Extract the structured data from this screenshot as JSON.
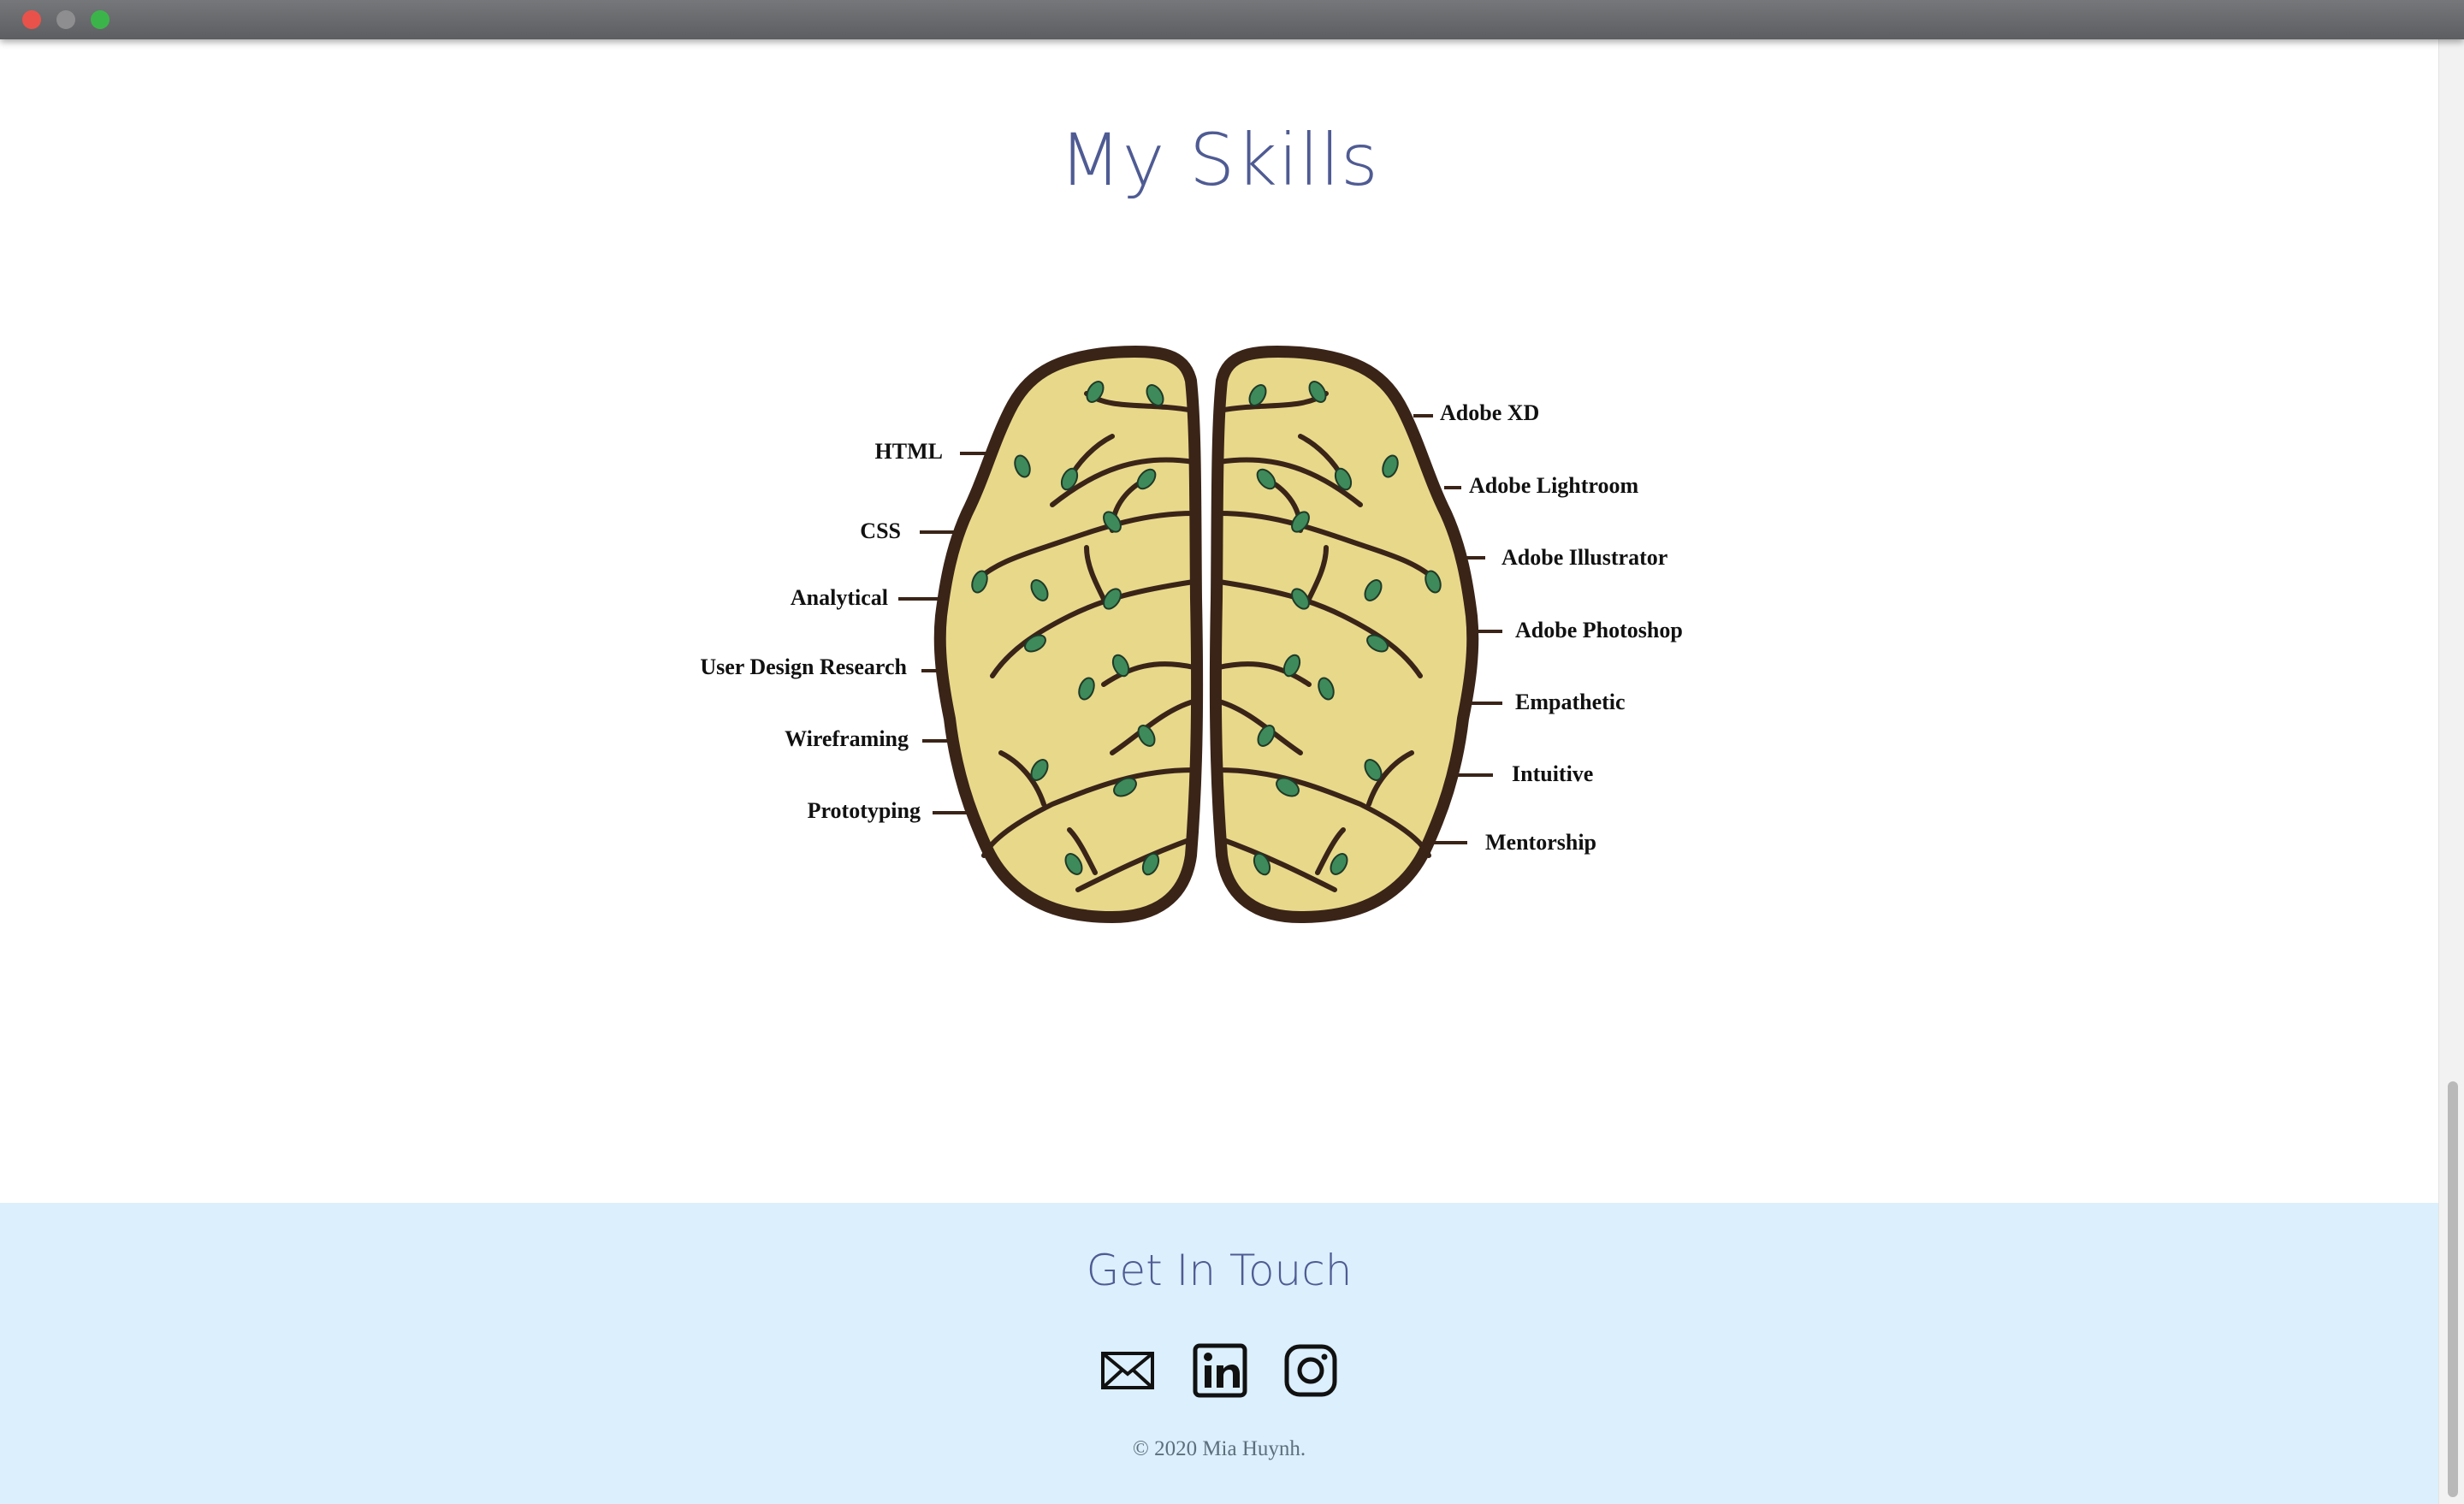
{
  "skills": {
    "title": "My Skills",
    "left_labels": [
      "HTML",
      "CSS",
      "Analytical",
      "User Design Research",
      "Wireframing",
      "Prototyping"
    ],
    "right_labels": [
      "Adobe XD",
      "Adobe Lightroom",
      "Adobe Illustrator",
      "Adobe Photoshop",
      "Empathetic",
      "Intuitive",
      "Mentorship"
    ]
  },
  "contact": {
    "title": "Get In Touch",
    "icons": [
      "email-icon",
      "linkedin-icon",
      "instagram-icon"
    ],
    "copyright": "© 2020 Mia Huynh."
  },
  "colors": {
    "heading": "#4f5b93",
    "footer_bg": "#dbeffc",
    "brain_fill": "#e8d88a",
    "brain_outline": "#3a2418",
    "leaf": "#3e8a5a"
  }
}
